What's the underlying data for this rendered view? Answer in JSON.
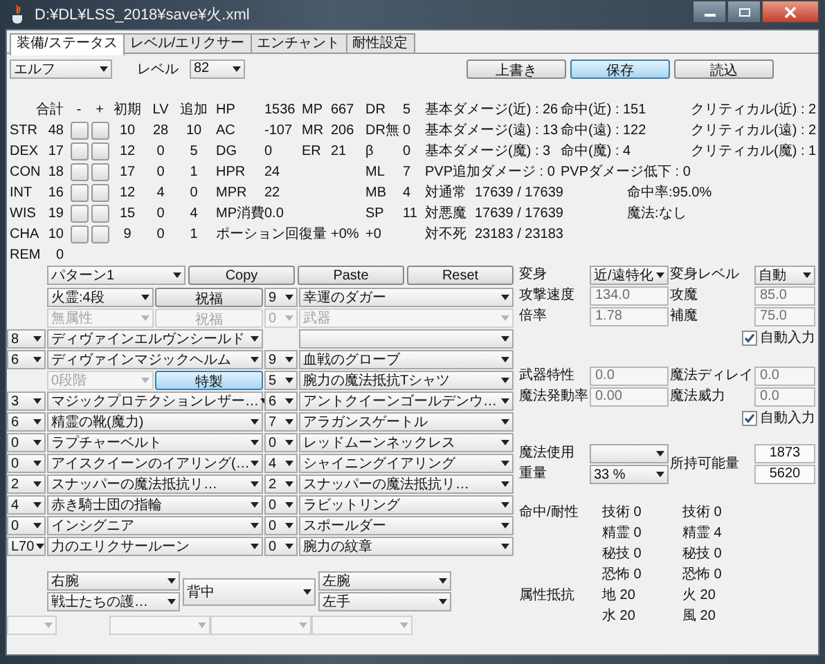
{
  "window": {
    "title": "D:¥DL¥LSS_2018¥save¥火.xml"
  },
  "tabs": [
    {
      "label": "装備/ステータス",
      "selected": true
    },
    {
      "label": "レベル/エリクサー",
      "selected": false
    },
    {
      "label": "エンチャント",
      "selected": false
    },
    {
      "label": "耐性設定",
      "selected": false
    }
  ],
  "race": {
    "value": "エルフ"
  },
  "level": {
    "label": "レベル",
    "value": "82"
  },
  "file_buttons": [
    {
      "label": "上書き",
      "selected": false
    },
    {
      "label": "保存",
      "selected": true
    },
    {
      "label": "読込",
      "selected": false
    }
  ],
  "stats": {
    "headers": [
      "合計",
      "-",
      "+",
      "初期",
      "LV",
      "追加"
    ],
    "rows": [
      {
        "name": "STR",
        "total": "48",
        "initial": "10",
        "lv": "28",
        "bonus": "10"
      },
      {
        "name": "DEX",
        "total": "17",
        "initial": "12",
        "lv": "0",
        "bonus": "5"
      },
      {
        "name": "CON",
        "total": "18",
        "initial": "17",
        "lv": "0",
        "bonus": "1"
      },
      {
        "name": "INT",
        "total": "16",
        "initial": "12",
        "lv": "4",
        "bonus": "0"
      },
      {
        "name": "WIS",
        "total": "19",
        "initial": "15",
        "lv": "0",
        "bonus": "4"
      },
      {
        "name": "CHA",
        "total": "10",
        "initial": "9",
        "lv": "0",
        "bonus": "1"
      }
    ],
    "rem": {
      "label": "REM",
      "value": "0"
    }
  },
  "combat": {
    "rows": [
      {
        "left": {
          "label": "HP",
          "value": "1536"
        },
        "mid": {
          "label": "MP",
          "value": "667"
        },
        "right": {
          "label": "DR",
          "value": "5"
        }
      },
      {
        "left": {
          "label": "AC",
          "value": "-107"
        },
        "mid": {
          "label": "MR",
          "value": "206"
        },
        "right": {
          "label": "DR無",
          "value": "0"
        }
      },
      {
        "left": {
          "label": "DG",
          "value": "0"
        },
        "mid": {
          "label": "ER",
          "value": "21"
        },
        "right": {
          "label": "β",
          "value": "0"
        }
      },
      {
        "left": {
          "label": "HPR",
          "value": "24"
        },
        "right": {
          "label": "ML",
          "value": "7"
        }
      },
      {
        "left": {
          "label": "MPR",
          "value": "22"
        },
        "right": {
          "label": "MB",
          "value": "4"
        }
      },
      {
        "left": {
          "label": "MP消費",
          "value": "0.0"
        },
        "right": {
          "label": "SP",
          "value": "11"
        }
      }
    ],
    "potion": {
      "label": "ポーション回復量",
      "values": [
        "+0%",
        "+0"
      ]
    }
  },
  "damage": {
    "rows": [
      {
        "c1": "基本ダメージ(近) : 26",
        "c2": "命中(近) : 151",
        "c3": "クリティカル(近) : 2"
      },
      {
        "c1": "基本ダメージ(遠) : 13",
        "c2": "命中(遠) : 122",
        "c3": "クリティカル(遠) : 2"
      },
      {
        "c1": "基本ダメージ(魔) : 3",
        "c2": "命中(魔) : 4",
        "c3": "クリティカル(魔) : 1"
      },
      {
        "c1": "PVP追加ダメージ : 0",
        "c2": "PVPダメージ低下 : 0"
      }
    ],
    "vs": [
      {
        "label": "対通常",
        "value": "17639 / 17639",
        "note": "命中率:95.0%"
      },
      {
        "label": "対悪魔",
        "value": "17639 / 17639",
        "note": "魔法:なし"
      },
      {
        "label": "対不死",
        "value": "23183 / 23183"
      }
    ]
  },
  "pattern": {
    "value": "パターン1",
    "buttons": [
      "Copy",
      "Paste",
      "Reset"
    ]
  },
  "equipment": [
    {
      "cells": [
        {
          "kind": "blank"
        },
        {
          "kind": "select",
          "value": "火霊:4段",
          "disabled": false
        },
        {
          "kind": "button",
          "label": "祝福",
          "selected": false,
          "disabled": false
        },
        {
          "kind": "select",
          "value": "9",
          "disabled": false
        },
        {
          "kind": "select",
          "value": "幸運のダガー",
          "disabled": false
        }
      ]
    },
    {
      "cells": [
        {
          "kind": "blank"
        },
        {
          "kind": "select",
          "value": "無属性",
          "disabled": true
        },
        {
          "kind": "button",
          "label": "祝福",
          "selected": false,
          "disabled": true
        },
        {
          "kind": "select",
          "value": "0",
          "disabled": true
        },
        {
          "kind": "select",
          "value": "武器",
          "disabled": true
        }
      ]
    },
    {
      "cells": [
        {
          "kind": "select",
          "value": "8",
          "disabled": false
        },
        {
          "kind": "wide",
          "value": "ディヴァインエルヴンシールド",
          "disabled": false
        },
        {
          "kind": "blank"
        },
        {
          "kind": "select",
          "disabled": false
        }
      ]
    },
    {
      "cells": [
        {
          "kind": "select",
          "value": "6",
          "disabled": false
        },
        {
          "kind": "wide",
          "value": "ディヴァインマジックヘルム",
          "disabled": false
        },
        {
          "kind": "select",
          "value": "9",
          "disabled": false
        },
        {
          "kind": "select",
          "value": "血戦のグローブ",
          "disabled": false
        }
      ]
    },
    {
      "cells": [
        {
          "kind": "blank"
        },
        {
          "kind": "select",
          "value": "0段階",
          "disabled": true
        },
        {
          "kind": "button",
          "label": "特製",
          "selected": true,
          "disabled": false
        },
        {
          "kind": "select",
          "value": "5",
          "disabled": false
        },
        {
          "kind": "select",
          "value": "腕力の魔法抵抗Tシャツ",
          "disabled": false
        }
      ]
    },
    {
      "cells": [
        {
          "kind": "select",
          "value": "3",
          "disabled": false
        },
        {
          "kind": "wide",
          "value": "マジックプロテクションレザー…",
          "disabled": false
        },
        {
          "kind": "select",
          "value": "6",
          "disabled": false
        },
        {
          "kind": "select",
          "value": "アントクイーンゴールデンウ…",
          "disabled": false
        }
      ]
    },
    {
      "cells": [
        {
          "kind": "select",
          "value": "6",
          "disabled": false
        },
        {
          "kind": "wide",
          "value": "精霊の靴(魔力)",
          "disabled": false
        },
        {
          "kind": "select",
          "value": "7",
          "disabled": false
        },
        {
          "kind": "select",
          "value": "アラガンスゲートル",
          "disabled": false
        }
      ]
    },
    {
      "cells": [
        {
          "kind": "select",
          "value": "0",
          "disabled": false
        },
        {
          "kind": "wide",
          "value": "ラプチャーベルト",
          "disabled": false
        },
        {
          "kind": "select",
          "value": "0",
          "disabled": false
        },
        {
          "kind": "select",
          "value": "レッドムーンネックレス",
          "disabled": false
        }
      ]
    },
    {
      "cells": [
        {
          "kind": "select",
          "value": "0",
          "disabled": false
        },
        {
          "kind": "wide",
          "value": "アイスクイーンのイアリング(…",
          "disabled": false
        },
        {
          "kind": "select",
          "value": "4",
          "disabled": false
        },
        {
          "kind": "select",
          "value": "シャイニングイアリング",
          "disabled": false
        }
      ]
    },
    {
      "cells": [
        {
          "kind": "select",
          "value": "2",
          "disabled": false
        },
        {
          "kind": "wide",
          "value": "スナッパーの魔法抵抗リ…",
          "disabled": false
        },
        {
          "kind": "select",
          "value": "2",
          "disabled": false
        },
        {
          "kind": "select",
          "value": "スナッパーの魔法抵抗リ…",
          "disabled": false
        }
      ]
    },
    {
      "cells": [
        {
          "kind": "select",
          "value": "4",
          "disabled": false
        },
        {
          "kind": "wide",
          "value": "赤き騎士団の指輪",
          "disabled": false
        },
        {
          "kind": "select",
          "value": "0",
          "disabled": false
        },
        {
          "kind": "select",
          "value": "ラビットリング",
          "disabled": false
        }
      ]
    },
    {
      "cells": [
        {
          "kind": "select",
          "value": "0",
          "disabled": false
        },
        {
          "kind": "wide",
          "value": "インシグニア",
          "disabled": false
        },
        {
          "kind": "select",
          "value": "0",
          "disabled": false
        },
        {
          "kind": "select",
          "value": "スポールダー",
          "disabled": false
        }
      ]
    },
    {
      "cells": [
        {
          "kind": "select",
          "value": "L70",
          "disabled": false
        },
        {
          "kind": "wide",
          "value": "力のエリクサールーン",
          "disabled": false
        },
        {
          "kind": "select",
          "value": "0",
          "disabled": false
        },
        {
          "kind": "select",
          "value": "腕力の紋章",
          "disabled": false
        }
      ]
    }
  ],
  "body_slots": {
    "right": [
      {
        "value": "右腕"
      },
      {
        "value": "戦士たちの護…"
      }
    ],
    "back": {
      "value": "背中"
    },
    "left": [
      {
        "value": "左腕"
      },
      {
        "value": "左手"
      }
    ]
  },
  "bottom_selects": [
    {
      "disabled": true
    },
    {
      "disabled": true
    },
    {
      "disabled": true
    },
    {
      "disabled": true
    }
  ],
  "form_groups": [
    {
      "items": [
        {
          "kind": "select",
          "label": "変身",
          "value": "近/遠特化"
        },
        {
          "kind": "select",
          "label": "変身レベル",
          "value": "自動"
        },
        {
          "kind": "field",
          "label": "攻撃速度",
          "value": "134.0"
        },
        {
          "kind": "field",
          "label": "攻魔",
          "value": "85.0"
        },
        {
          "kind": "field",
          "label": "倍率",
          "value": "1.78"
        },
        {
          "kind": "field",
          "label": "補魔",
          "value": "75.0"
        },
        {
          "kind": "checkbox",
          "label": "自動入力",
          "checked": true
        }
      ]
    },
    {
      "items": [
        {
          "kind": "field",
          "label": "武器特性",
          "value": "0.0"
        },
        {
          "kind": "field",
          "label": "魔法ディレイ",
          "value": "0.0"
        },
        {
          "kind": "field",
          "label": "魔法発動率",
          "value": "0.00"
        },
        {
          "kind": "field",
          "label": "魔法威力",
          "value": "0.0"
        },
        {
          "kind": "checkbox",
          "label": "自動入力",
          "checked": true
        }
      ]
    }
  ],
  "load": {
    "magic": {
      "label": "魔法使用"
    },
    "weight": {
      "label": "重量",
      "value": "33 %"
    },
    "capacity": {
      "label": "所持可能量",
      "values": [
        "1873",
        "5620"
      ]
    }
  },
  "resistances": [
    {
      "label": "命中/耐性",
      "rows": [
        [
          "技術 0",
          "技術 0"
        ],
        [
          "精霊 0",
          "精霊 4"
        ],
        [
          "秘技 0",
          "秘技 0"
        ],
        [
          "恐怖 0",
          "恐怖 0"
        ]
      ]
    },
    {
      "label": "属性抵抗",
      "rows": [
        [
          "地 20",
          "火 20"
        ],
        [
          "水 20",
          "風 20"
        ]
      ]
    }
  ]
}
